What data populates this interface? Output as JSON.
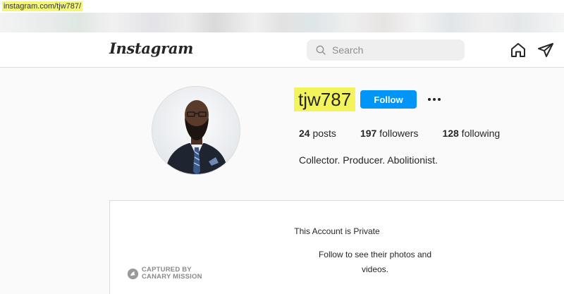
{
  "browser": {
    "url": "instagram.com/tjw787/"
  },
  "header": {
    "logo": "Instagram",
    "search_placeholder": "Search"
  },
  "profile": {
    "username": "tjw787",
    "follow_label": "Follow",
    "stats": {
      "posts_count": "24",
      "posts_label": " posts",
      "followers_count": "197",
      "followers_label": " followers",
      "following_count": "128",
      "following_label": " following"
    },
    "bio": "Collector. Producer. Abolitionist."
  },
  "private_notice": {
    "title": "This Account is Private",
    "subtitle": "Follow to see their photos and videos."
  },
  "watermark": {
    "line1": "CAPTURED BY",
    "line2": "CANARY MISSION"
  },
  "colors": {
    "follow_button": "#0095f6",
    "highlight": "#f3f45c"
  }
}
